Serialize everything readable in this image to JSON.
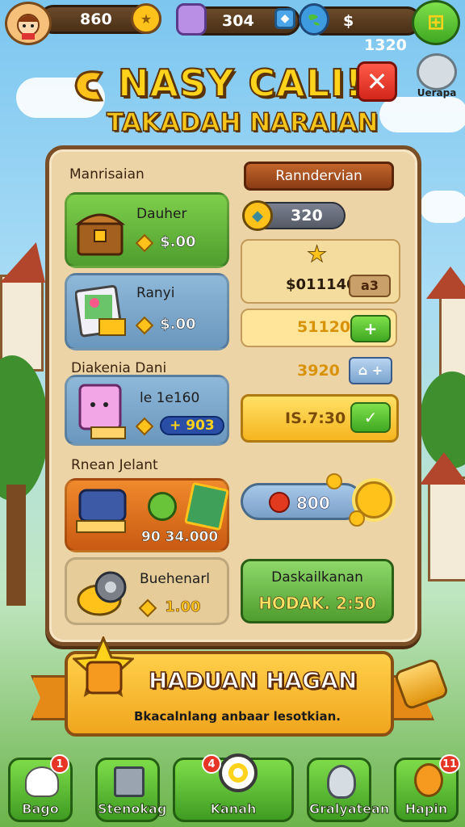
{
  "topbar": {
    "coins": "860",
    "gems": "304",
    "money_symbol": "$",
    "money": "1320"
  },
  "title": {
    "line1": "NASY CALI!",
    "line2": "TAKADAH NARAIAN",
    "badge_label": "Uerapa"
  },
  "panel": {
    "left_header": "Manrisaian",
    "right_header": "Ranndervian",
    "currency_value": "320",
    "items": [
      {
        "name": "Dauher",
        "price": "$.00"
      },
      {
        "name": "Ranyi",
        "price": "$.00"
      },
      {
        "name": "le 1e160",
        "price": "+ 903"
      }
    ],
    "section2_label": "Diakenia Dani",
    "section3_label": "Rnean Jelant",
    "orange_card_value": "90 34.000",
    "tan_card_name": "Buehenarl",
    "tan_card_price": "1.00",
    "rows": [
      {
        "value": "$011140",
        "tag": "a3"
      },
      {
        "value": "51120",
        "tag": "+"
      },
      {
        "value": "3920",
        "tag": "⌂ +"
      },
      {
        "value": "IS.7:30",
        "tag": "✓"
      }
    ],
    "fruit_value": "800",
    "green_box_title": "Daskailkanan",
    "green_box_value": "HODAK. 2:50"
  },
  "banner": {
    "title": "HADUAN HAGAN",
    "subtitle": "Bkacalnlang anbaar lesotkian."
  },
  "nav": [
    {
      "label": "Bago",
      "badge": "1"
    },
    {
      "label": "Stenokag",
      "badge": ""
    },
    {
      "label": "Kanah",
      "badge": "4"
    },
    {
      "label": "Gralyatean",
      "badge": ""
    },
    {
      "label": "Hapin",
      "badge": "11"
    }
  ],
  "colors": {
    "accent_green": "#4f9d2e",
    "panel_bg": "#ecd4a6",
    "gold": "#ffc21a"
  }
}
